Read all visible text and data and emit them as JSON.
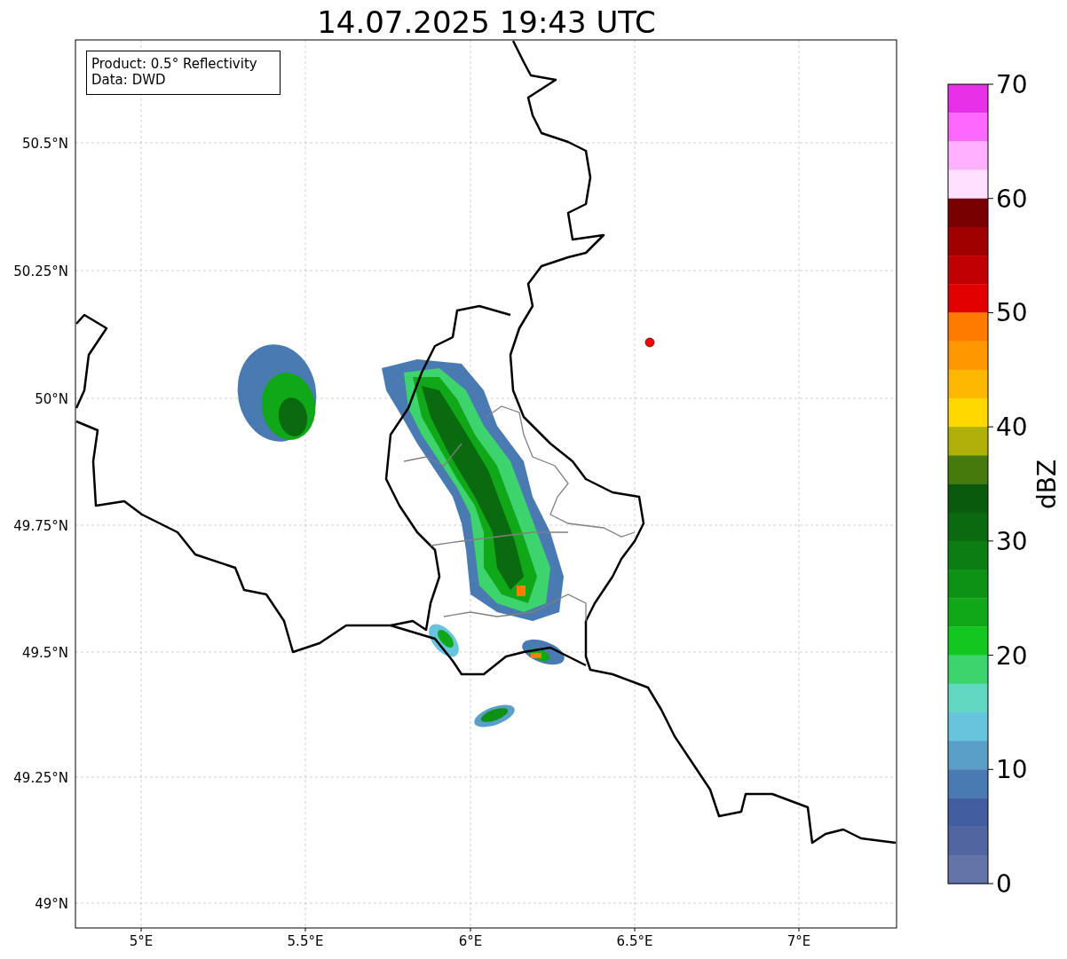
{
  "title": "14.07.2025 19:43 UTC",
  "legend": [
    "Product: 0.5° Reflectivity",
    "Data: DWD"
  ],
  "map": {
    "lon_ticks": [
      "5°E",
      "5.5°E",
      "6°E",
      "6.5°E",
      "7°E"
    ],
    "lat_ticks": [
      "50.5°N",
      "50.25°N",
      "50°N",
      "49.75°N",
      "49.5°N",
      "49.25°N",
      "49°N"
    ]
  },
  "colorbar": {
    "label": "dBZ",
    "ticks": [
      "70",
      "60",
      "50",
      "40",
      "30",
      "20",
      "10",
      "0"
    ],
    "bands": [
      {
        "color": "#e830e8"
      },
      {
        "color": "#ff68ff"
      },
      {
        "color": "#ffb0ff"
      },
      {
        "color": "#ffe0ff"
      },
      {
        "color": "#780000"
      },
      {
        "color": "#a00000"
      },
      {
        "color": "#c00000"
      },
      {
        "color": "#e30000"
      },
      {
        "color": "#ff7c00"
      },
      {
        "color": "#ff9800"
      },
      {
        "color": "#ffb800"
      },
      {
        "color": "#ffd800"
      },
      {
        "color": "#b0b00a"
      },
      {
        "color": "#467a0c"
      },
      {
        "color": "#0a5a0e"
      },
      {
        "color": "#0a6a10"
      },
      {
        "color": "#0c7d12"
      },
      {
        "color": "#0e9215"
      },
      {
        "color": "#10a818"
      },
      {
        "color": "#12c71f"
      },
      {
        "color": "#3dd46e"
      },
      {
        "color": "#62d8c3"
      },
      {
        "color": "#68c4dc"
      },
      {
        "color": "#5a9fc7"
      },
      {
        "color": "#4a7ab2"
      },
      {
        "color": "#425da0"
      },
      {
        "color": "#5166a0"
      },
      {
        "color": "#6474a8"
      }
    ]
  }
}
